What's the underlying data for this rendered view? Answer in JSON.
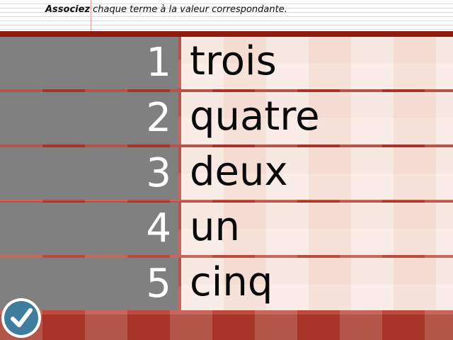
{
  "instruction": {
    "bold": "Associez",
    "rest": " chaque terme à la valeur correspondante."
  },
  "rows": [
    {
      "number": "1",
      "term": "trois"
    },
    {
      "number": "2",
      "term": "quatre"
    },
    {
      "number": "3",
      "term": "deux"
    },
    {
      "number": "4",
      "term": "un"
    },
    {
      "number": "5",
      "term": "cinq"
    }
  ],
  "validate_button": {
    "icon": "checkmark-icon"
  },
  "colors": {
    "number_cell": "#808080",
    "term_cell": "#f7e2da",
    "board": "#b93a2c",
    "board_band": "#8e1a12",
    "check_button": "#3f7c9d"
  }
}
